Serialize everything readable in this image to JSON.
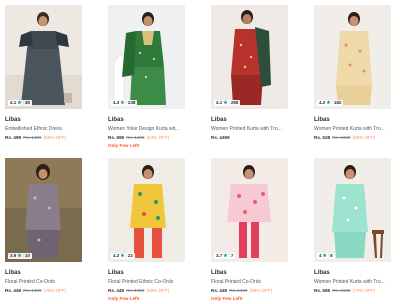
{
  "products": [
    {
      "brand": "Libas",
      "title": "Embellished Ethnic Dress",
      "price": "Rs. 499",
      "mrp": "Rs. 1499",
      "discount": "(66% OFF)",
      "rating": "4.1",
      "reviews": "38",
      "urgency": ""
    },
    {
      "brand": "Libas",
      "title": "Women Yoke Design Kurta wit...",
      "price": "Rs. 699",
      "mrp": "Rs. 1499",
      "discount": "(53% OFF)",
      "rating": "4.3",
      "reviews": "238",
      "urgency": "Only Few Left!"
    },
    {
      "brand": "Libas",
      "title": "Women Printed Kurta with Tro...",
      "price": "Rs. 4499",
      "mrp": "",
      "discount": "",
      "rating": "4.1",
      "reviews": "255",
      "urgency": ""
    },
    {
      "brand": "Libas",
      "title": "Women Printed Kurta with Tro...",
      "price": "Rs. 528",
      "mrp": "Rs. 1699",
      "discount": "(69% OFF)",
      "rating": "4.2",
      "reviews": "182",
      "urgency": ""
    },
    {
      "brand": "Libas",
      "title": "Floral Printed Co-Ords",
      "price": "Rs. 449",
      "mrp": "Rs. 1499",
      "discount": "(70% OFF)",
      "rating": "3.9",
      "reviews": "10",
      "urgency": ""
    },
    {
      "brand": "Libas",
      "title": "Floral Printed Ethnic Co-Ords",
      "price": "Rs. 449",
      "mrp": "Rs. 1499",
      "discount": "(69% OFF)",
      "rating": "4.2",
      "reviews": "22",
      "urgency": "Only Few Left!"
    },
    {
      "brand": "Libas",
      "title": "Floral Printed Co-Ords",
      "price": "Rs. 449",
      "mrp": "Rs. 1499",
      "discount": "(69% OFF)",
      "rating": "3.7",
      "reviews": "7",
      "urgency": "Only Few Left!"
    },
    {
      "brand": "Libas",
      "title": "Women Printed Kurta with Tro...",
      "price": "Rs. 599",
      "mrp": "Rs. 1999",
      "discount": "(70% OFF)",
      "rating": "4",
      "reviews": "8",
      "urgency": ""
    }
  ],
  "icons": {
    "rating_star": "star-icon"
  },
  "colors": {
    "rating_star": "#14958f",
    "discount": "#ff905a",
    "urgency": "#ff5722"
  }
}
